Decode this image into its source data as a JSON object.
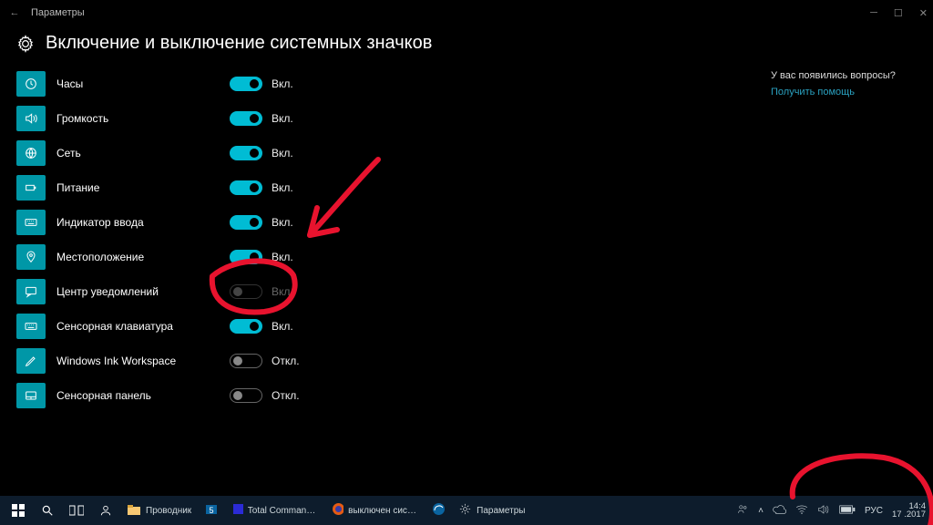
{
  "window": {
    "app": "Параметры"
  },
  "header": {
    "title": "Включение и выключение системных значков"
  },
  "help": {
    "question": "У вас появились вопросы?",
    "link": "Получить помощь"
  },
  "labels": {
    "on": "Вкл.",
    "off": "Откл."
  },
  "items": [
    {
      "key": "clock",
      "label": "Часы",
      "state": "on",
      "icon": "clock"
    },
    {
      "key": "volume",
      "label": "Громкость",
      "state": "on",
      "icon": "volume"
    },
    {
      "key": "network",
      "label": "Сеть",
      "state": "on",
      "icon": "globe"
    },
    {
      "key": "power",
      "label": "Питание",
      "state": "on",
      "icon": "battery"
    },
    {
      "key": "input",
      "label": "Индикатор ввода",
      "state": "on",
      "icon": "keyboard"
    },
    {
      "key": "location",
      "label": "Местоположение",
      "state": "on",
      "icon": "pin"
    },
    {
      "key": "action-center",
      "label": "Центр уведомлений",
      "state": "locked",
      "icon": "message"
    },
    {
      "key": "touchkb",
      "label": "Сенсорная клавиатура",
      "state": "on",
      "icon": "keyboard"
    },
    {
      "key": "ink",
      "label": "Windows Ink Workspace",
      "state": "off",
      "icon": "pen"
    },
    {
      "key": "touchpad",
      "label": "Сенсорная панель",
      "state": "off",
      "icon": "touchpad"
    }
  ],
  "taskbar": {
    "apps": [
      {
        "key": "explorer",
        "label": "Проводник"
      },
      {
        "key": "outlook",
        "label": ""
      },
      {
        "key": "totalcmd",
        "label": "Total Commander (..."
      },
      {
        "key": "firefox",
        "label": "выключен систем..."
      },
      {
        "key": "edge",
        "label": ""
      },
      {
        "key": "settings",
        "label": "Параметры"
      }
    ],
    "tray": {
      "lang": "РУС",
      "time": "14:4",
      "date": "17    .2017"
    }
  },
  "colors": {
    "accent": "#00bcd4",
    "iconbox": "#0097a7",
    "taskbar": "#0d1c2c"
  }
}
